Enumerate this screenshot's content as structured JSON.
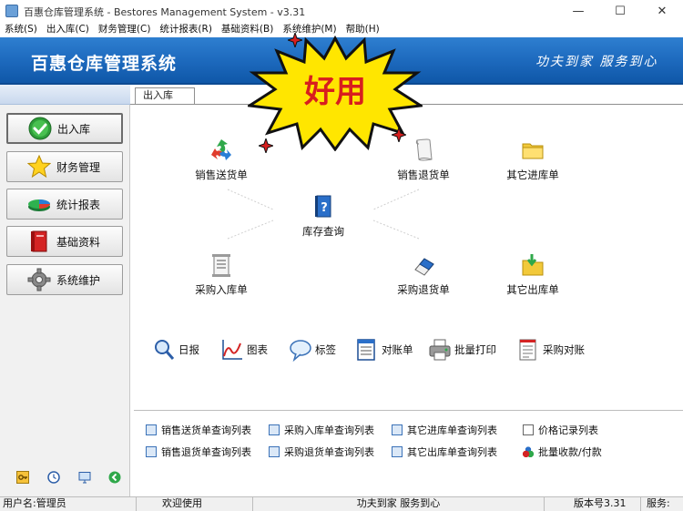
{
  "window": {
    "title": "百惠仓库管理系统 - Bestores Management System - v3.31",
    "minimize": "—",
    "maximize": "☐",
    "close": "✕"
  },
  "menu": [
    "系统(S)",
    "出入库(C)",
    "财务管理(C)",
    "统计报表(R)",
    "基础资料(B)",
    "系统维护(M)",
    "帮助(H)"
  ],
  "banner": {
    "title": "百惠仓库管理系统",
    "slogan": "功夫到家 服务到心",
    "burst_text": "好用",
    "burst_color": "#ffe600",
    "accent": "#1f6cc0"
  },
  "sidebar": {
    "items": [
      {
        "label": "出入库",
        "icon": "check-circle-icon"
      },
      {
        "label": "财务管理",
        "icon": "star-icon"
      },
      {
        "label": "统计报表",
        "icon": "pie-chart-icon"
      },
      {
        "label": "基础资料",
        "icon": "book-icon"
      },
      {
        "label": "系统维护",
        "icon": "gear-icon"
      }
    ],
    "tools": [
      "key-icon",
      "clock-icon",
      "monitor-icon",
      "back-arrow-icon"
    ]
  },
  "tab": {
    "label": "出入库"
  },
  "main": {
    "sales_delivery": "销售送货单",
    "sales_return": "销售退货单",
    "other_in": "其它进库单",
    "inventory_query": "库存查询",
    "purchase_in": "采购入库单",
    "purchase_return": "采购退货单",
    "other_out": "其它出库单"
  },
  "quick": [
    {
      "label": "日报",
      "icon": "magnifier-icon"
    },
    {
      "label": "图表",
      "icon": "line-chart-icon"
    },
    {
      "label": "标签",
      "icon": "speech-bubble-icon"
    },
    {
      "label": "对账单",
      "icon": "statement-icon"
    },
    {
      "label": "批量打印",
      "icon": "printer-icon"
    },
    {
      "label": "采购对账",
      "icon": "document-icon"
    }
  ],
  "links": [
    "销售送货单查询列表",
    "采购入库单查询列表",
    "其它进库单查询列表",
    "价格记录列表",
    "销售退货单查询列表",
    "采购退货单查询列表",
    "其它出库单查询列表",
    "批量收款/付款"
  ],
  "status": {
    "user": "用户名:管理员",
    "welcome": "欢迎使用",
    "slogan": "功夫到家 服务到心",
    "version": "版本号3.31",
    "service": "服务:"
  }
}
